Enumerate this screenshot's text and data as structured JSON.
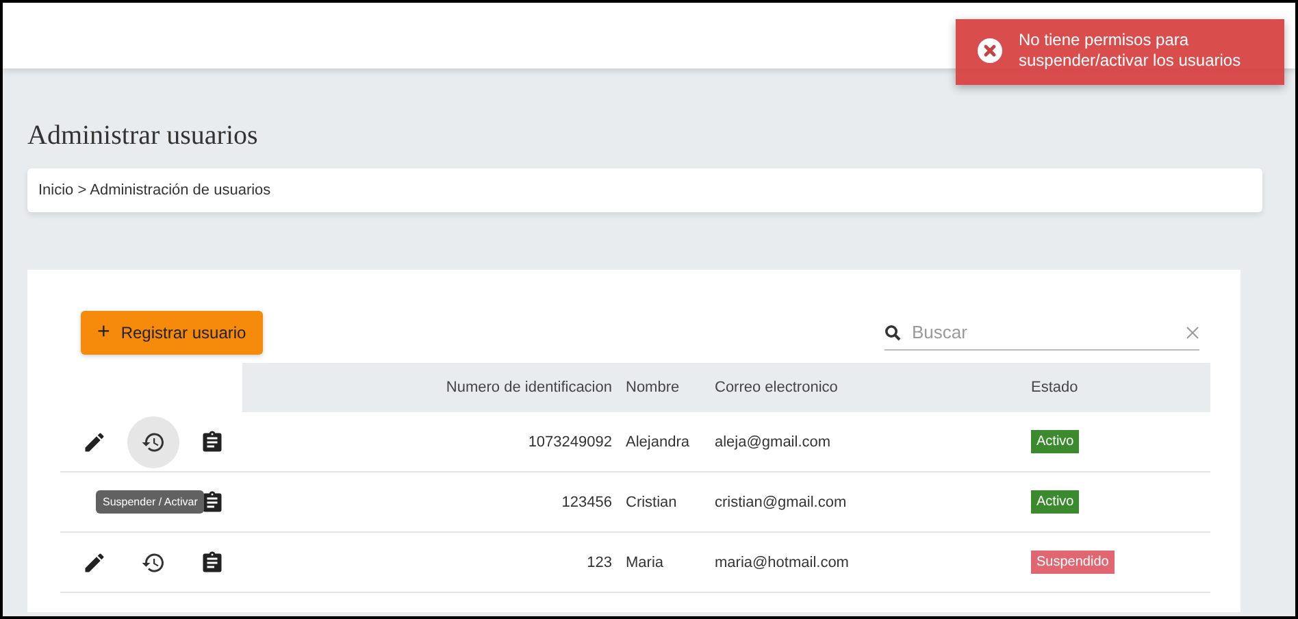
{
  "toast": {
    "message": "No tiene permisos para suspender/activar los usuarios"
  },
  "page_title": "Administrar usuarios",
  "breadcrumb": "Inicio > Administración de usuarios",
  "toolbar": {
    "add_button": "Registrar usuario",
    "add_icon": "+",
    "search": {
      "placeholder": "Buscar"
    }
  },
  "table": {
    "columns": [
      "Numero de identificacion",
      "Nombre",
      "Correo electronico",
      "Estado"
    ],
    "rows": [
      {
        "id": "1073249092",
        "name": "Alejandra",
        "email": "aleja@gmail.com",
        "status": "Activo",
        "color": "#3b8a2e",
        "hovered": true
      },
      {
        "id": "123456",
        "name": "Cristian",
        "email": "cristian@gmail.com",
        "status": "Activo",
        "color": "#3b8a2e",
        "hovered": false
      },
      {
        "id": "123",
        "name": "Maria",
        "email": "maria@hotmail.com",
        "status": "Suspendido",
        "color": "#e06671",
        "hovered": false
      }
    ]
  },
  "tooltip": {
    "text": "Suspender / Activar"
  }
}
